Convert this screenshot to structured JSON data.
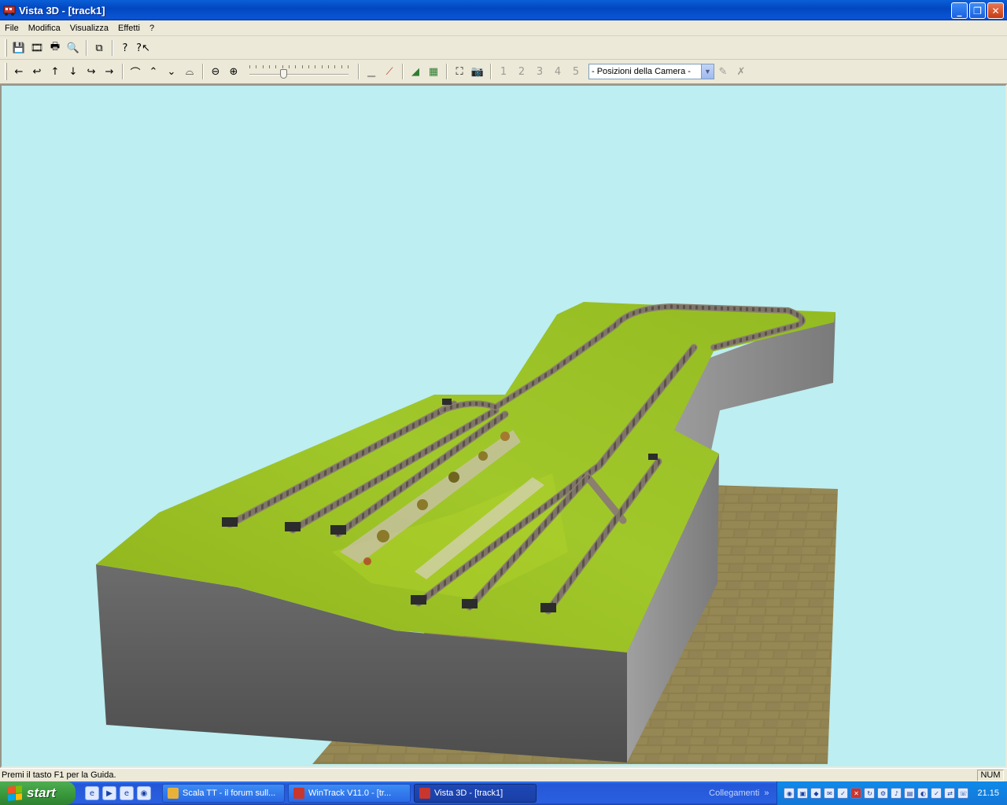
{
  "window": {
    "title": "Vista 3D - [track1]",
    "buttons": {
      "minimize": "_",
      "restore": "❐",
      "close": "✕"
    }
  },
  "menu": [
    "File",
    "Modifica",
    "Visualizza",
    "Effetti",
    "?"
  ],
  "toolbar1": {
    "icons": [
      "save-icon",
      "film-icon",
      "print-icon",
      "print-preview-icon",
      "copy-icon",
      "help-icon",
      "context-help-icon"
    ],
    "glyphs": [
      "💾",
      "🎞",
      "🖶",
      "🔍",
      "⧉",
      "?",
      "?↖"
    ]
  },
  "toolbar2": {
    "nav_glyphs": [
      "←",
      "↩",
      "↑",
      "↓",
      "↪",
      "→"
    ],
    "camera_glyphs": [
      "⌒",
      "⌃",
      "⌄",
      "⌓"
    ],
    "zoom_glyphs": [
      "⊖",
      "⊕"
    ],
    "slider_value": 0.33,
    "track_glyphs": [
      "▁",
      "⟋"
    ],
    "terrain_glyphs": [
      "◢",
      "▦"
    ],
    "view_glyphs": [
      "⛶",
      "📷"
    ],
    "camera_slots": [
      "1",
      "2",
      "3",
      "4",
      "5"
    ],
    "camera_combo": "- Posizioni della Camera -",
    "camera_tools": [
      "✎",
      "✗"
    ]
  },
  "viewport": {
    "sky_color": "#bdeef1",
    "grass_color": "#9cc21a",
    "cliff_color": "#5e5e5e",
    "floor_color": "#8a7c4a"
  },
  "status": {
    "text": "Premi il tasto F1 per la Guida.",
    "num": "NUM"
  },
  "taskbar": {
    "start": "start",
    "quicklaunch": [
      "e",
      "▶",
      "e",
      "◉"
    ],
    "tasks": [
      {
        "label": "Scala TT - il forum sull...",
        "color": "#e8b23a",
        "active": false
      },
      {
        "label": "WinTrack  V11.0 - [tr...",
        "color": "#c8362e",
        "active": false
      },
      {
        "label": "Vista 3D - [track1]",
        "color": "#c8362e",
        "active": true
      }
    ],
    "links_label": "Collegamenti",
    "links_chevron": "»",
    "tray_count": 14,
    "clock": "21.15"
  }
}
